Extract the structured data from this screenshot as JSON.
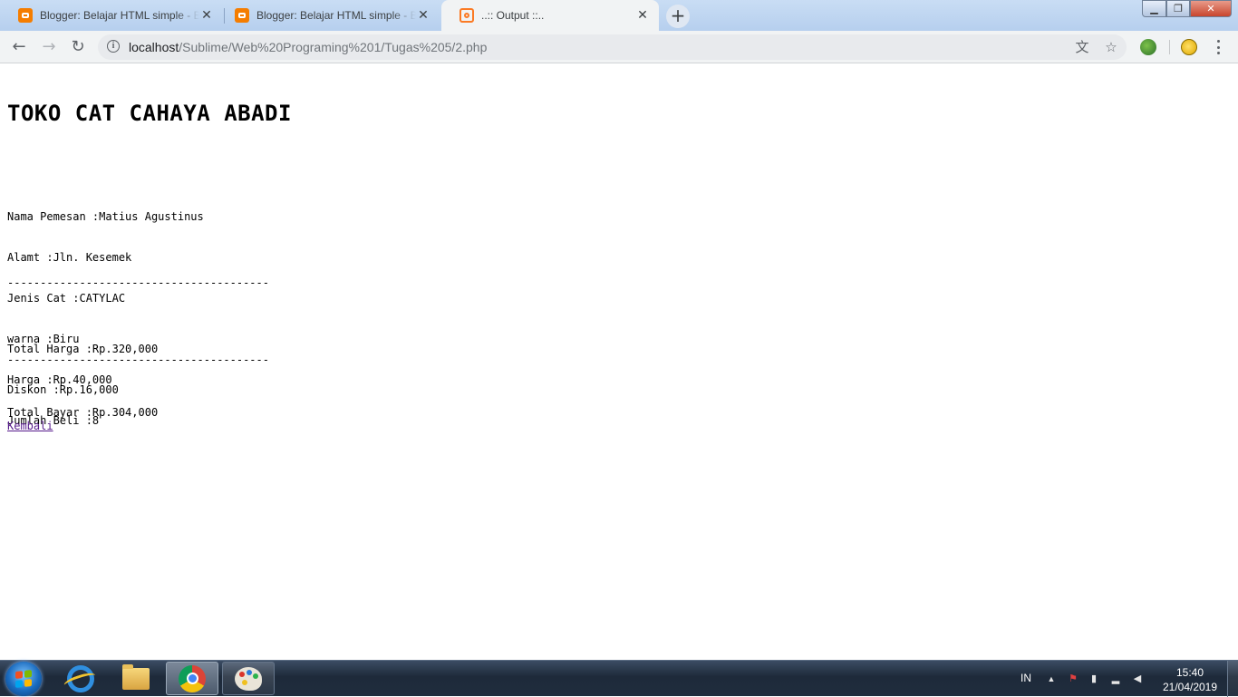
{
  "browser": {
    "tabs": [
      {
        "title": "Blogger: Belajar HTML simple - B",
        "favicon": "blogger-icon",
        "active": false
      },
      {
        "title": "Blogger: Belajar HTML simple - B",
        "favicon": "blogger-icon",
        "active": false
      },
      {
        "title": "..:: Output ::..",
        "favicon": "xampp-icon",
        "active": true
      }
    ],
    "new_tab_icon": "plus-icon",
    "close_glyph": "✕",
    "address": {
      "host": "localhost",
      "path": "/Sublime/Web%20Programing%201/Tugas%205/2.php"
    }
  },
  "page": {
    "heading": "TOKO CAT CAHAYA ABADI",
    "order_lines": [
      "Nama Pemesan :Matius Agustinus",
      "Alamt :Jln. Kesemek",
      "Jenis Cat :CATYLAC",
      "warna :Biru",
      "Harga :Rp.40,000",
      "Jumlah Beli :8"
    ],
    "separator": "----------------------------------------",
    "price_lines": [
      "Total Harga :Rp.320,000",
      "Diskon :Rp.16,000"
    ],
    "total_line": "Total Bayar :Rp.304,000",
    "back_link": "Kembali"
  },
  "taskbar": {
    "language": "IN",
    "time": "15:40",
    "date": "21/04/2019",
    "apps": [
      "internet-explorer-icon",
      "file-explorer-icon",
      "chrome-icon",
      "paint-icon"
    ]
  },
  "colors": {
    "blogger": "#f57d00",
    "xampp": "#fb7a24",
    "visited_link": "#551a8b",
    "tabstrip": "#c9ddf4",
    "toolbar": "#f1f3f4"
  }
}
